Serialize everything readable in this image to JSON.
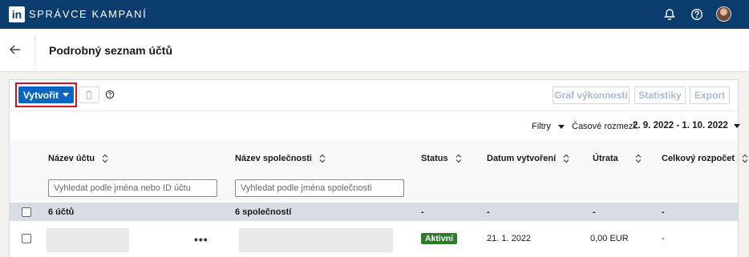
{
  "app": {
    "logo_text": "in",
    "title": "SPRÁVCE KAMPANÍ",
    "icons": [
      "bell-icon",
      "help-icon",
      "avatar"
    ]
  },
  "header": {
    "back_icon": "arrow-left-icon",
    "title": "Podrobný seznam účtů"
  },
  "toolbar": {
    "create_label": "Vytvořit",
    "delete_icon": "trash-icon",
    "help_icon": "help-icon",
    "performance_chart_label": "Graf výkonnosti",
    "statistics_label": "Statistiky",
    "export_label": "Export"
  },
  "filters": {
    "filters_label": "Filtry",
    "date_range_label": "Časové rozmezí:",
    "date_range_value": "2. 9. 2022 - 1. 10. 2022"
  },
  "table": {
    "columns": [
      {
        "label": "Název účtu",
        "sortable": true
      },
      {
        "label": "Název společnosti",
        "sortable": true
      },
      {
        "label": "Status",
        "sortable": true
      },
      {
        "label": "Datum vytvoření",
        "sortable": true
      },
      {
        "label": "Útrata",
        "sortable": true
      },
      {
        "label": "Celkový rozpočet",
        "sortable": true
      }
    ],
    "search_account_placeholder": "Vyhledat podle jména nebo ID účtu",
    "search_company_placeholder": "Vyhledat podle jména společnosti",
    "summary": {
      "accounts": "6 účtů",
      "companies": "6 společností",
      "status": "-",
      "created": "-",
      "spend": "-",
      "budget": "-"
    },
    "rows": [
      {
        "more": "•••",
        "status": "Aktivní",
        "created": "21. 1. 2022",
        "spend": "0,00 EUR",
        "budget": "-"
      }
    ]
  },
  "colors": {
    "topbar": "#0a3d6e",
    "primary": "#0a66c2",
    "highlight": "#d11124",
    "active_badge": "#2f7d2a"
  }
}
